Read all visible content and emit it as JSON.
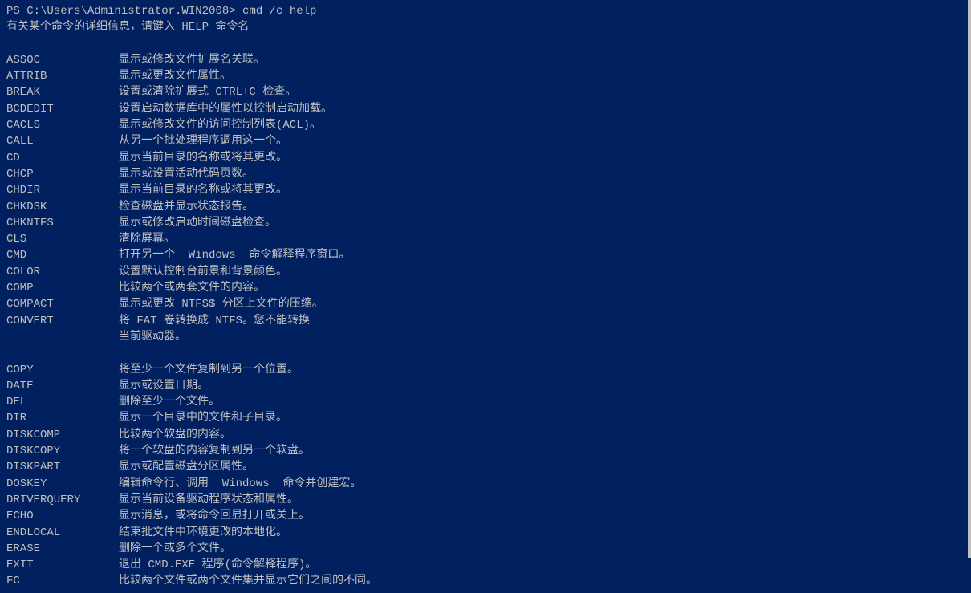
{
  "terminal": {
    "prompt": "PS C:\\Users\\Administrator.WIN2008> cmd /c help",
    "intro": "有关某个命令的详细信息，请键入 HELP 命令名",
    "commands": [
      {
        "name": "ASSOC",
        "desc": "显示或修改文件扩展名关联。"
      },
      {
        "name": "ATTRIB",
        "desc": "显示或更改文件属性。"
      },
      {
        "name": "BREAK",
        "desc": "设置或清除扩展式 CTRL+C 检查。"
      },
      {
        "name": "BCDEDIT",
        "desc": "设置启动数据库中的属性以控制启动加载。"
      },
      {
        "name": "CACLS",
        "desc": "显示或修改文件的访问控制列表(ACL)。"
      },
      {
        "name": "CALL",
        "desc": "从另一个批处理程序调用这一个。"
      },
      {
        "name": "CD",
        "desc": "显示当前目录的名称或将其更改。"
      },
      {
        "name": "CHCP",
        "desc": "显示或设置活动代码页数。"
      },
      {
        "name": "CHDIR",
        "desc": "显示当前目录的名称或将其更改。"
      },
      {
        "name": "CHKDSK",
        "desc": "检查磁盘并显示状态报告。"
      },
      {
        "name": "CHKNTFS",
        "desc": "显示或修改启动时间磁盘检查。"
      },
      {
        "name": "CLS",
        "desc": "清除屏幕。"
      },
      {
        "name": "CMD",
        "desc": "打开另一个  Windows  命令解释程序窗口。"
      },
      {
        "name": "COLOR",
        "desc": "设置默认控制台前景和背景颜色。"
      },
      {
        "name": "COMP",
        "desc": "比较两个或两套文件的内容。"
      },
      {
        "name": "COMPACT",
        "desc": "显示或更改 NTFS$ 分区上文件的压缩。"
      },
      {
        "name": "CONVERT",
        "desc": "将 FAT 卷转换成 NTFS。您不能转换\n               当前驱动器。"
      },
      {
        "name": "COPY",
        "desc": "将至少一个文件复制到另一个位置。"
      },
      {
        "name": "DATE",
        "desc": "显示或设置日期。"
      },
      {
        "name": "DEL",
        "desc": "删除至少一个文件。"
      },
      {
        "name": "DIR",
        "desc": "显示一个目录中的文件和子目录。"
      },
      {
        "name": "DISKCOMP",
        "desc": "比较两个软盘的内容。"
      },
      {
        "name": "DISKCOPY",
        "desc": "将一个软盘的内容复制到另一个软盘。"
      },
      {
        "name": "DISKPART",
        "desc": "显示或配置磁盘分区属性。"
      },
      {
        "name": "DOSKEY",
        "desc": "编辑命令行、调用  Windows  命令并创建宏。"
      },
      {
        "name": "DRIVERQUERY",
        "desc": "显示当前设备驱动程序状态和属性。"
      },
      {
        "name": "ECHO",
        "desc": "显示消息，或将命令回显打开或关上。"
      },
      {
        "name": "ENDLOCAL",
        "desc": "结束批文件中环境更改的本地化。"
      },
      {
        "name": "ERASE",
        "desc": "删除一个或多个文件。"
      },
      {
        "name": "EXIT",
        "desc": "退出 CMD.EXE 程序(命令解释程序)。"
      },
      {
        "name": "FC",
        "desc": "比较两个文件或两个文件集并显示它们之间的不同。"
      }
    ]
  }
}
